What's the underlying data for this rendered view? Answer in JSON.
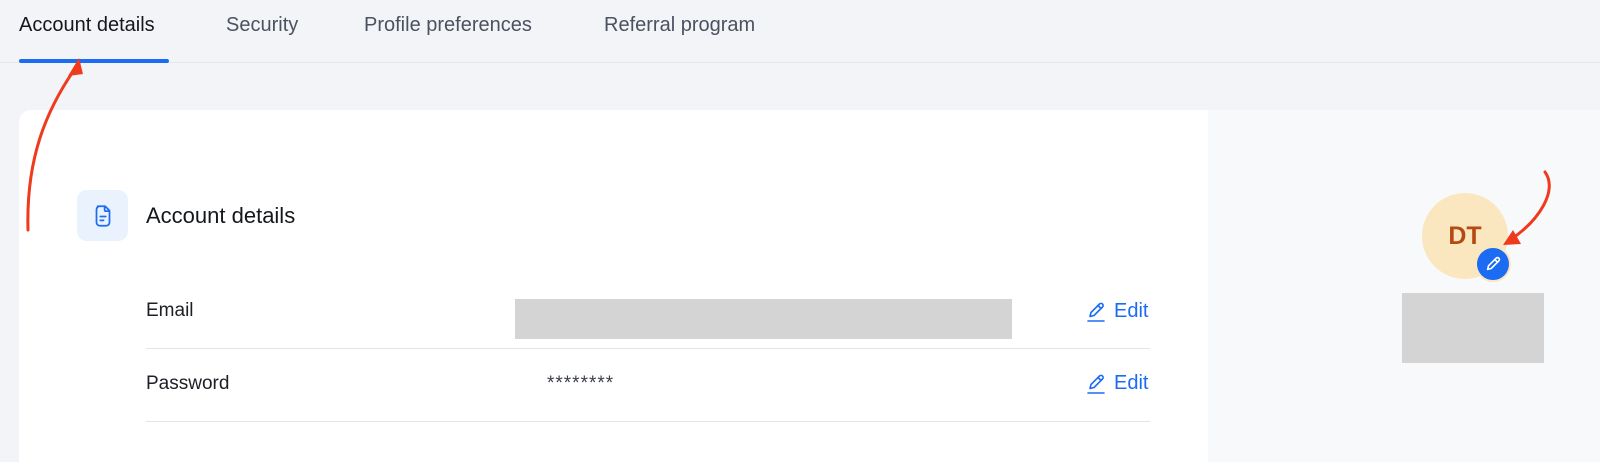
{
  "tabs": [
    {
      "label": "Account details",
      "active": true
    },
    {
      "label": "Security"
    },
    {
      "label": "Profile preferences"
    },
    {
      "label": "Referral program"
    }
  ],
  "section": {
    "title": "Account details",
    "icon": "document-icon"
  },
  "rows": [
    {
      "label": "Email",
      "value_redacted": true,
      "edit_label": "Edit"
    },
    {
      "label": "Password",
      "value": "********",
      "edit_label": "Edit"
    }
  ],
  "profile": {
    "initials": "DT",
    "name_redacted": true,
    "edit_icon": "pencil-icon"
  },
  "colors": {
    "accent": "#1c6cf3",
    "annotation": "#f03a1e",
    "avatar_bg": "#fbe7bf",
    "avatar_text": "#b54a10"
  }
}
